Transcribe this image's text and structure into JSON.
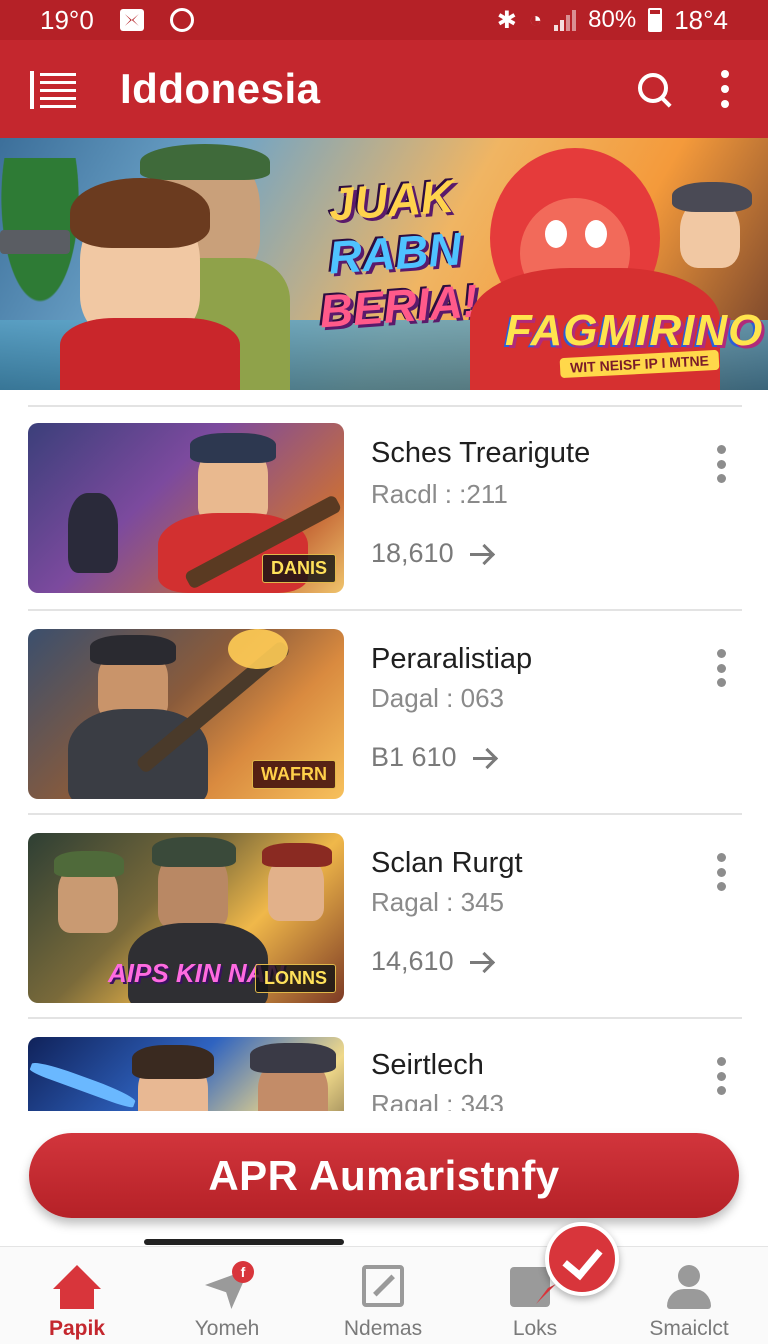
{
  "status_bar": {
    "time_left": "19°0",
    "battery": "80%",
    "time_right": "18°4"
  },
  "app_bar": {
    "title": "Iddonesia"
  },
  "banner": {
    "slogan_lines": [
      "JUAK",
      "RABN",
      "BERIA!"
    ],
    "brand": "FAGMIRINO",
    "tagline": "WIT NEISF IP I MTNE"
  },
  "games": [
    {
      "title": "Sches Trearigute",
      "subtitle": "Racdl : :211",
      "count": "18,610",
      "thumb_label": "DANIS"
    },
    {
      "title": "Peraralistiap",
      "subtitle": "Dagal : 063",
      "count": "B1 610",
      "thumb_label": "WAFRN"
    },
    {
      "title": "Sclan Rurgt",
      "subtitle": "Ragal : 345",
      "count": "14,610",
      "thumb_label": "LONNS",
      "thumb_logo": "AIPS KIN NAN"
    },
    {
      "title": "Seirtlech",
      "subtitle": "Ragal : 343"
    }
  ],
  "cta": {
    "label": "APR Aumaristnfy"
  },
  "bottom_nav": {
    "items": [
      {
        "label": "Papik",
        "icon": "home-icon",
        "active": true
      },
      {
        "label": "Yomeh",
        "icon": "send-icon",
        "badge": "f"
      },
      {
        "label": "Ndemas",
        "icon": "edit-icon"
      },
      {
        "label": "Loks",
        "icon": "cube-icon"
      },
      {
        "label": "Smaiclct",
        "icon": "user-icon"
      }
    ]
  },
  "colors": {
    "primary": "#c4272e",
    "status_bar": "#b52127",
    "accent": "#d8353b"
  }
}
